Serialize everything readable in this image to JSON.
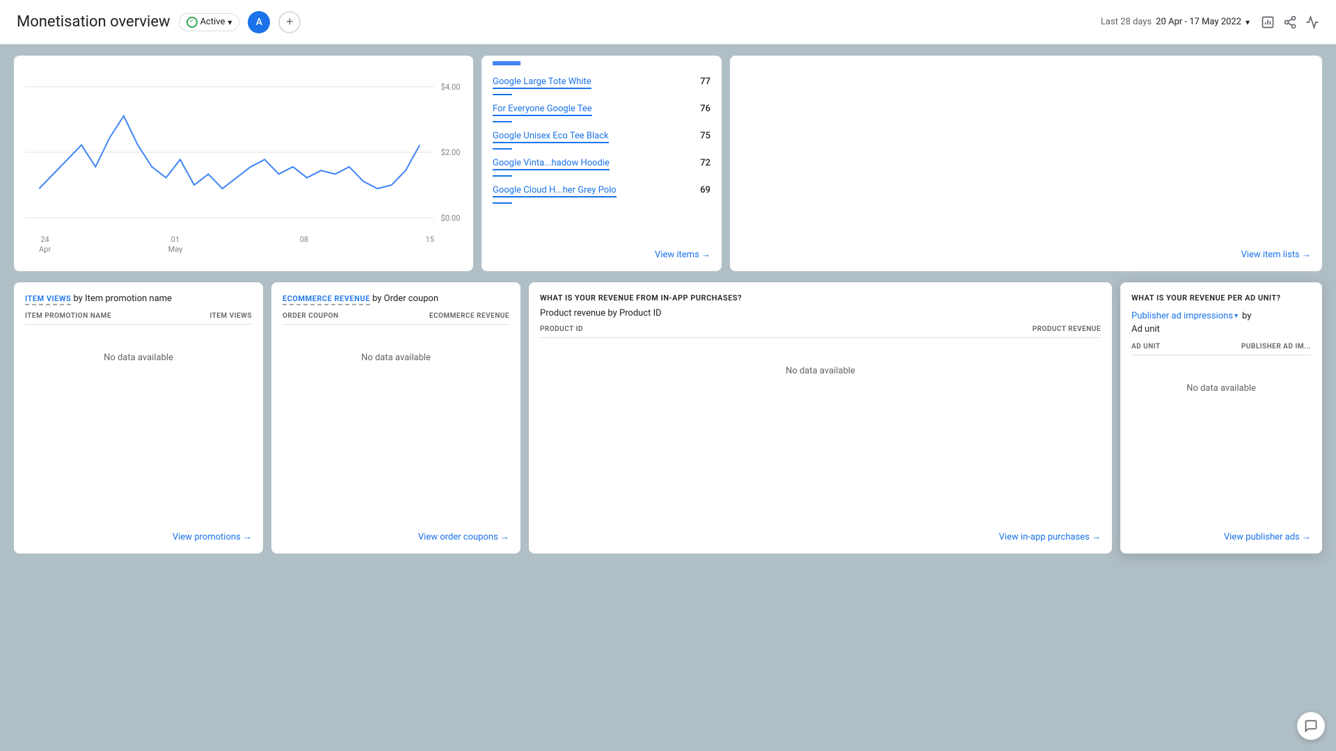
{
  "header": {
    "title": "Monetisation overview",
    "status": "Active",
    "avatar_initial": "A",
    "date_prefix": "Last 28 days",
    "date_range": "20 Apr - 17 May 2022"
  },
  "chart": {
    "y_labels": [
      "$4.00",
      "$2.00",
      "$0.00"
    ],
    "x_labels": [
      {
        "value": "24",
        "sub": "Apr"
      },
      {
        "value": "01",
        "sub": "May"
      },
      {
        "value": "08",
        "sub": ""
      },
      {
        "value": "15",
        "sub": ""
      }
    ]
  },
  "top_items": {
    "section_label": "",
    "items": [
      {
        "name": "Google Large Tote White",
        "value": "77"
      },
      {
        "name": "For Everyone Google Tee",
        "value": "76"
      },
      {
        "name": "Google Unisex Eco Tee Black",
        "value": "75"
      },
      {
        "name": "Google Vinta...hadow Hoodie",
        "value": "72"
      },
      {
        "name": "Google Cloud H...her Grey Polo",
        "value": "69"
      }
    ],
    "view_link": "View items →"
  },
  "item_lists": {
    "view_link": "View item lists →"
  },
  "bottom_panels": {
    "panel1": {
      "title": "Item Views by Item promotion name",
      "title_main": "Item Views",
      "title_suffix": "by Item promotion name",
      "col1": "ITEM PROMOTION NAME",
      "col2": "ITEM VIEWS",
      "no_data": "No data available",
      "view_link": "View promotions →"
    },
    "panel2": {
      "title": "Ecommerce revenue by Order coupon",
      "title_main": "Ecommerce revenue",
      "title_suffix": "by Order coupon",
      "col1": "ORDER COUPON",
      "col2": "ECOMMERCE REVENUE",
      "no_data": "No data available",
      "view_link": "View order coupons →"
    },
    "panel3": {
      "title": "WHAT IS YOUR REVENUE FROM IN-APP PURCHASES?",
      "sub_title": "Product revenue by Product ID",
      "col1": "PRODUCT ID",
      "col2": "PRODUCT REVENUE",
      "no_data": "No data available",
      "view_link": "View in-app purchases →"
    },
    "panel4": {
      "title": "WHAT IS YOUR REVENUE PER AD UNIT?",
      "metric": "Publisher ad impressions",
      "by": "by",
      "group_by": "Ad unit",
      "col1": "AD UNIT",
      "col2": "PUBLISHER AD IM...",
      "no_data": "No data available",
      "view_link": "View publisher ads →"
    }
  },
  "feedback_icon": "💬"
}
